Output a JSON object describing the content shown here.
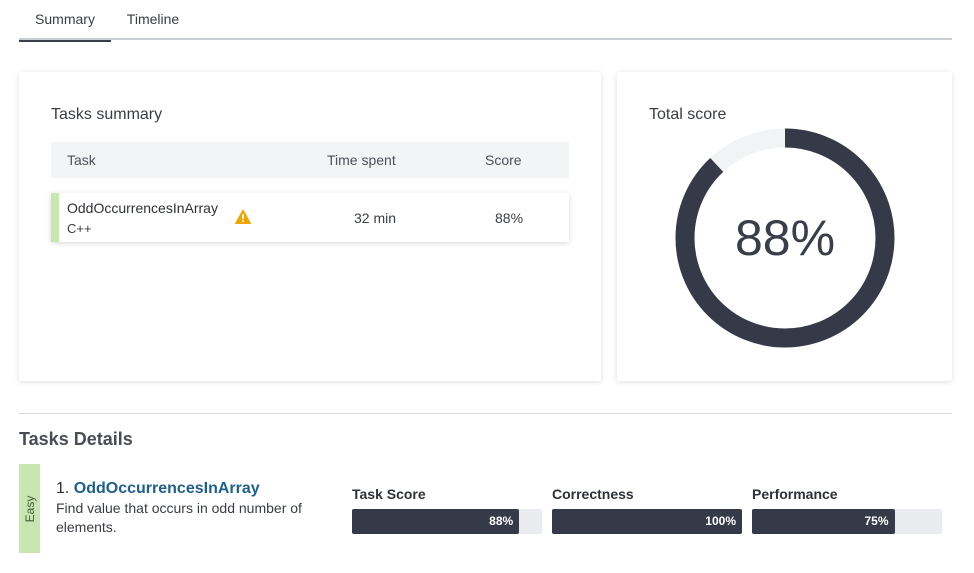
{
  "tabs": [
    {
      "label": "Summary",
      "active": true
    },
    {
      "label": "Timeline",
      "active": false
    }
  ],
  "tasks_summary": {
    "title": "Tasks summary",
    "columns": [
      "Task",
      "Time spent",
      "Score"
    ],
    "rows": [
      {
        "name": "OddOccurrencesInArray",
        "language": "C++",
        "time_spent": "32 min",
        "score": "88%",
        "icon": "warning-icon"
      }
    ]
  },
  "total_score": {
    "title": "Total score",
    "value_label": "88%",
    "fraction": 0.88
  },
  "details": {
    "title": "Tasks Details",
    "tasks": [
      {
        "difficulty": "Easy",
        "number": "1.",
        "name": "OddOccurrencesInArray",
        "description": "Find value that occurs in odd number of elements.",
        "metrics": [
          {
            "label": "Task Score",
            "value_label": "88%",
            "fraction": 0.88
          },
          {
            "label": "Correctness",
            "value_label": "100%",
            "fraction": 1.0
          },
          {
            "label": "Performance",
            "value_label": "75%",
            "fraction": 0.75
          }
        ]
      }
    ]
  },
  "colors": {
    "accent_dark": "#363947",
    "track": "#f2f3f5",
    "easy_green": "#c8e6b0",
    "link": "#1f5f8b",
    "warning": "#f0a400"
  }
}
